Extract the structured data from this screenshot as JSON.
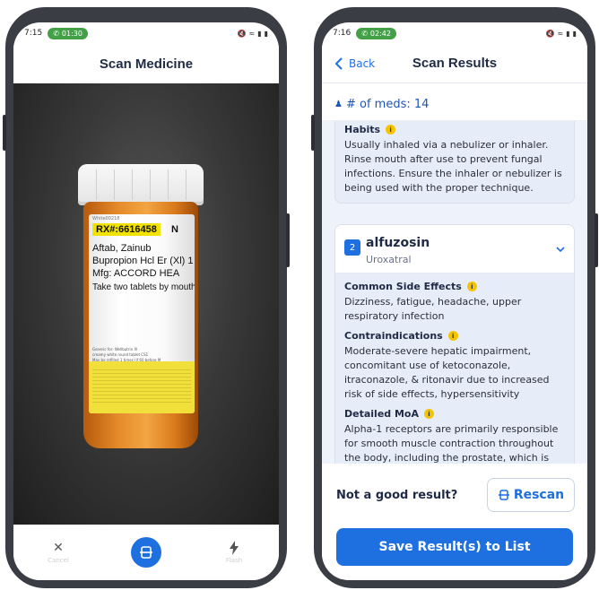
{
  "left_phone": {
    "status": {
      "time": "7:15",
      "call_timer": "01:30",
      "icons": "signal-wifi-battery-icons"
    },
    "header": {
      "title": "Scan Medicine"
    },
    "bottle_label": {
      "rx_number": "RX#:6616458",
      "rx_suffix": "N",
      "top_small": "White00218",
      "patient": "Aftab, Zainub",
      "drug_line": "Bupropion Hcl Er (Xl) 1",
      "mfg": "Mfg: ACCORD HEA",
      "directions": "Take two tablets by mouth",
      "generic_for": "Generic for: Wellbutrin Xl",
      "description": "creamy white round tablet CS1",
      "refills": "May be refilled 1 times (if 60 before M"
    },
    "bottom_bar": {
      "cancel_label": "Cancel",
      "flash_label": "Flash"
    }
  },
  "right_phone": {
    "status": {
      "time": "7:16",
      "call_timer": "02:42",
      "icons": "signal-wifi-battery-icons"
    },
    "header": {
      "back_label": "Back",
      "title": "Scan Results"
    },
    "meds_count": "# of meds: 14",
    "card1": {
      "section_title": "Habits",
      "text": "Usually inhaled via a nebulizer or inhaler. Rinse mouth after use to prevent fungal infections. Ensure the inhaler or nebulizer is being used with the proper technique."
    },
    "card2": {
      "number": "2",
      "name": "alfuzosin",
      "brand": "Uroxatral",
      "sections": [
        {
          "title": "Common Side Effects",
          "text": "Dizziness, fatigue, headache, upper respiratory infection"
        },
        {
          "title": "Contraindications",
          "text": "Moderate-severe hepatic impairment, concomitant use of ketoconazole, itraconazole, & ritonavir due to increased risk of side effects, hypersensitivity"
        },
        {
          "title": "Detailed MoA",
          "text": "Alpha-1 receptors are primarily responsible for smooth muscle contraction throughout the body, including the prostate, which is"
        }
      ]
    },
    "footer": {
      "not_good": "Not a good result?",
      "rescan_label": "Rescan",
      "save_label": "Save Result(s) to List"
    }
  },
  "colors": {
    "accent": "#1e6fe0",
    "call_green": "#43a047",
    "info_yellow": "#f5c400"
  }
}
